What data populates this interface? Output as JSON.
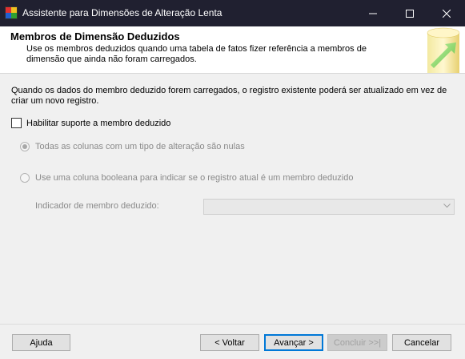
{
  "window": {
    "title": "Assistente para Dimensões de Alteração Lenta"
  },
  "header": {
    "title": "Membros de Dimensão Deduzidos",
    "description": "Use os membros deduzidos quando uma tabela de fatos fizer referência a membros de dimensão que ainda não foram carregados."
  },
  "body": {
    "info": "Quando os dados do membro deduzido forem carregados, o registro existente poderá ser atualizado em vez de criar um novo registro.",
    "enable_checkbox": {
      "label": "Habilitar suporte a membro deduzido",
      "checked": false
    },
    "option_all_null": {
      "label": "Todas as colunas com um tipo de alteração são nulas",
      "selected": true,
      "enabled": false
    },
    "option_boolean": {
      "label": "Use uma coluna booleana para indicar se o registro atual é um membro deduzido",
      "selected": false,
      "enabled": false
    },
    "indicator": {
      "label": "Indicador de membro deduzido:",
      "value": ""
    }
  },
  "footer": {
    "help": "Ajuda",
    "back": "< Voltar",
    "next": "Avançar >",
    "finish": "Concluir >>|",
    "cancel": "Cancelar"
  },
  "icons": {
    "app": "wizard-app-icon",
    "header_graphic": "wizard-banner-graphic"
  },
  "colors": {
    "titlebar": "#202030",
    "accent": "#0078d7",
    "disabled_text": "#8a8a8a"
  }
}
